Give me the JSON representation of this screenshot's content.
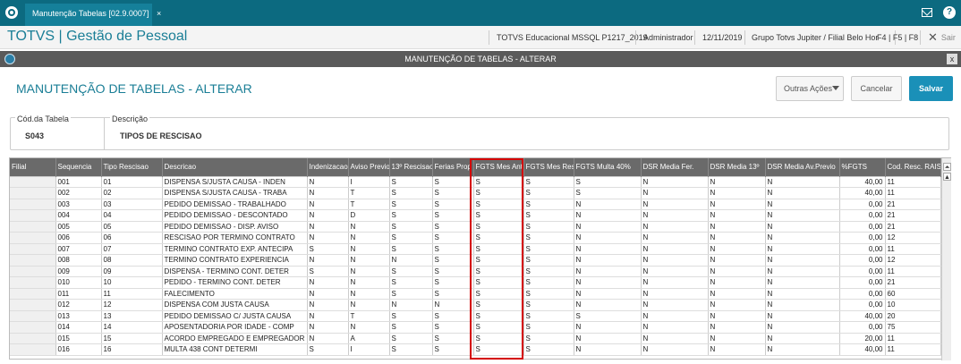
{
  "topbar": {
    "tab_label": "Manutenção Tabelas [02.9.0007]",
    "tab_close": "×"
  },
  "appbar": {
    "title": "TOTVS | Gestão de Pessoal",
    "environment": "TOTVS Educacional MSSQL P1217_2019",
    "user": "Administrador",
    "date": "12/11/2019",
    "branch": "Grupo Totvs Jupiter / Filial Belo Hor",
    "shortcuts": "F4 | F5 | F8",
    "exit_label": "Sair"
  },
  "window": {
    "title": "MANUTENÇÃO DE TABELAS - ALTERAR",
    "close": "x"
  },
  "form": {
    "title": "MANUTENÇÃO DE TABELAS - ALTERAR",
    "buttons": {
      "outras": "Outras Ações",
      "cancel": "Cancelar",
      "save": "Salvar"
    },
    "cod_label": "Cód.da Tabela",
    "cod_value": "S043",
    "desc_label": "Descrição",
    "desc_value": "TIPOS DE RESCISAO"
  },
  "grid": {
    "columns": [
      "Filial",
      "Sequencia",
      "Tipo Rescisao",
      "Descricao",
      "Indenizacao",
      "Aviso Previo",
      "13º Rescisao",
      "Ferias Prop",
      "FGTS Mes Ant",
      "FGTS Mes Res",
      "FGTS Multa 40%",
      "DSR Media Fer.",
      "DSR Media 13º",
      "DSR Media Av.Previo",
      "%FGTS",
      "Cod. Resc. RAIS"
    ],
    "rows": [
      [
        "",
        "001",
        "01",
        "DISPENSA S/JUSTA CAUSA - INDEN",
        "N",
        "I",
        "S",
        "S",
        "S",
        "S",
        "S",
        "N",
        "N",
        "N",
        "40,00",
        "11"
      ],
      [
        "",
        "002",
        "02",
        "DISPENSA S/JUSTA CAUSA - TRABA",
        "N",
        "T",
        "S",
        "S",
        "S",
        "S",
        "S",
        "N",
        "N",
        "N",
        "40,00",
        "11"
      ],
      [
        "",
        "003",
        "03",
        "PEDIDO DEMISSAO - TRABALHADO",
        "N",
        "T",
        "S",
        "S",
        "S",
        "S",
        "N",
        "N",
        "N",
        "N",
        "0,00",
        "21"
      ],
      [
        "",
        "004",
        "04",
        "PEDIDO DEMISSAO - DESCONTADO",
        "N",
        "D",
        "S",
        "S",
        "S",
        "S",
        "N",
        "N",
        "N",
        "N",
        "0,00",
        "21"
      ],
      [
        "",
        "005",
        "05",
        "PEDIDO DEMISSAO - DISP. AVISO",
        "N",
        "N",
        "S",
        "S",
        "S",
        "S",
        "N",
        "N",
        "N",
        "N",
        "0,00",
        "21"
      ],
      [
        "",
        "006",
        "06",
        "RESCISAO POR TERMINO CONTRATO",
        "N",
        "N",
        "S",
        "S",
        "S",
        "S",
        "N",
        "N",
        "N",
        "N",
        "0,00",
        "12"
      ],
      [
        "",
        "007",
        "07",
        "TERMINO CONTRATO EXP. ANTECIPA",
        "S",
        "N",
        "S",
        "S",
        "S",
        "S",
        "N",
        "N",
        "N",
        "N",
        "0,00",
        "11"
      ],
      [
        "",
        "008",
        "08",
        "TERMINO CONTRATO EXPERIENCIA",
        "N",
        "N",
        "N",
        "S",
        "S",
        "S",
        "N",
        "N",
        "N",
        "N",
        "0,00",
        "12"
      ],
      [
        "",
        "009",
        "09",
        "DISPENSA - TERMINO CONT. DETER",
        "S",
        "N",
        "S",
        "S",
        "S",
        "S",
        "N",
        "N",
        "N",
        "N",
        "0,00",
        "11"
      ],
      [
        "",
        "010",
        "10",
        "PEDIDO - TERMINO CONT. DETER",
        "N",
        "N",
        "S",
        "S",
        "S",
        "S",
        "N",
        "N",
        "N",
        "N",
        "0,00",
        "21"
      ],
      [
        "",
        "011",
        "11",
        "FALECIMENTO",
        "N",
        "N",
        "S",
        "S",
        "S",
        "S",
        "N",
        "N",
        "N",
        "N",
        "0,00",
        "60"
      ],
      [
        "",
        "012",
        "12",
        "DISPENSA COM JUSTA CAUSA",
        "N",
        "N",
        "N",
        "N",
        "S",
        "S",
        "N",
        "N",
        "N",
        "N",
        "0,00",
        "10"
      ],
      [
        "",
        "013",
        "13",
        "PEDIDO DEMISSAO C/ JUSTA CAUSA",
        "N",
        "T",
        "S",
        "S",
        "S",
        "S",
        "S",
        "N",
        "N",
        "N",
        "40,00",
        "20"
      ],
      [
        "",
        "014",
        "14",
        "APOSENTADORIA POR IDADE - COMP",
        "N",
        "N",
        "S",
        "S",
        "S",
        "S",
        "N",
        "N",
        "N",
        "N",
        "0,00",
        "75"
      ],
      [
        "",
        "015",
        "15",
        "ACORDO EMPREGADO E EMPREGADOR",
        "N",
        "A",
        "S",
        "S",
        "S",
        "S",
        "N",
        "N",
        "N",
        "N",
        "20,00",
        "11"
      ],
      [
        "",
        "016",
        "16",
        "MULTA 438 CONT DETERMI",
        "S",
        "I",
        "S",
        "S",
        "S",
        "S",
        "N",
        "N",
        "N",
        "N",
        "40,00",
        "11"
      ]
    ]
  },
  "colors": {
    "topbar": "#0c6a80",
    "accent": "#1a7e96",
    "save": "#1a90b8",
    "header": "#6a6a6a",
    "highlight": "#d40000"
  },
  "icons": [
    "totvs-logo-icon",
    "mail-icon",
    "help-icon",
    "close-icon",
    "window-logo-icon",
    "chevron-down-icon",
    "scroll-top-icon",
    "scroll-up-icon"
  ]
}
